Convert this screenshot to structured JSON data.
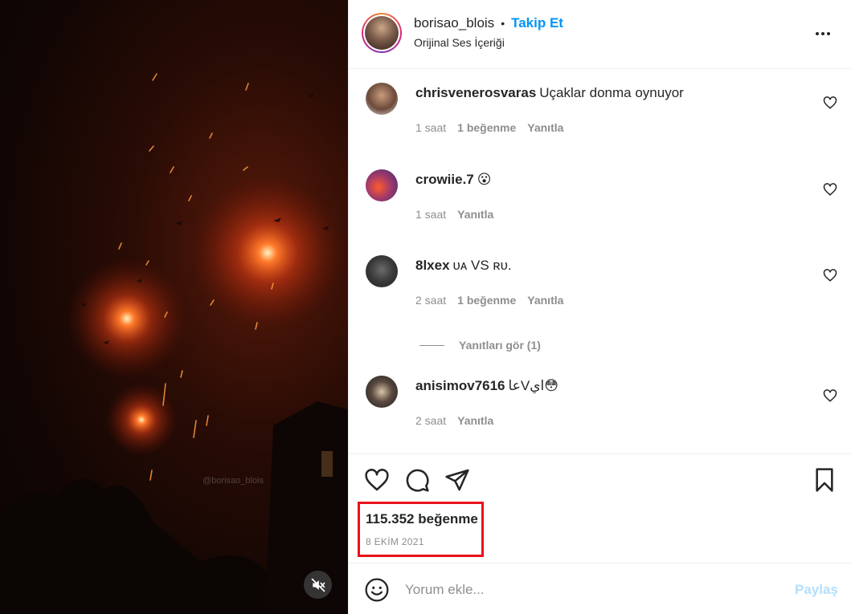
{
  "post": {
    "owner_username": "borisao_blois",
    "separator": "•",
    "follow_label": "Takip Et",
    "audio_label": "Orijinal Ses İçeriği",
    "watermark": "@borisao_blois"
  },
  "comments": [
    {
      "username": "chrisvenerosvaras",
      "text": "Uçaklar donma oynuyor",
      "time": "1 saat",
      "likes": "1 beğenme",
      "reply": "Yanıtla"
    },
    {
      "username": "crowiie.7",
      "text": "😮",
      "time": "1 saat",
      "likes": "",
      "reply": "Yanıtla"
    },
    {
      "username": "8lxex",
      "text": "ᴜᴀ VS ʀᴜ.",
      "time": "2 saat",
      "likes": "1 beğenme",
      "reply": "Yanıtla"
    },
    {
      "username": "anisimov7616",
      "text": "عاVاي😳",
      "time": "2 saat",
      "likes": "",
      "reply": "Yanıtla"
    }
  ],
  "view_replies_label": "Yanıtları gör (1)",
  "stats": {
    "likes": "115.352 beğenme",
    "date": "8 EKİM 2021"
  },
  "add_comment": {
    "placeholder": "Yorum ekle...",
    "post_label": "Paylaş"
  },
  "colors": {
    "accent": "#0095f6",
    "highlight_box": "#e8131b",
    "post_disabled": "#b2dffc"
  }
}
